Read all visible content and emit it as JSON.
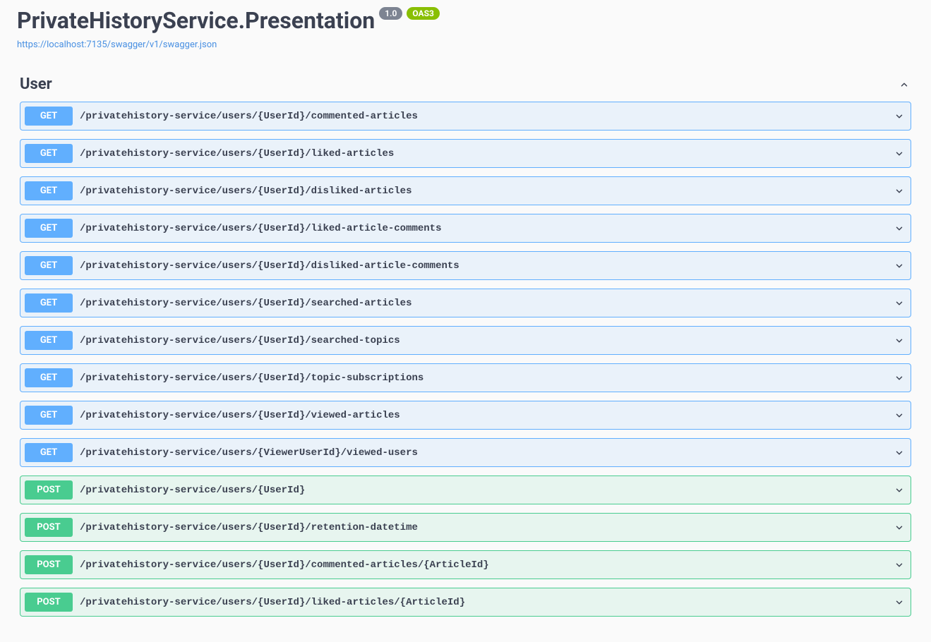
{
  "header": {
    "title": "PrivateHistoryService.Presentation",
    "version": "1.0",
    "oas": "OAS3",
    "spec_url": "https://localhost:7135/swagger/v1/swagger.json"
  },
  "tag": {
    "name": "User"
  },
  "operations": [
    {
      "method": "GET",
      "path": "/privatehistory-service/users/{UserId}/commented-articles"
    },
    {
      "method": "GET",
      "path": "/privatehistory-service/users/{UserId}/liked-articles"
    },
    {
      "method": "GET",
      "path": "/privatehistory-service/users/{UserId}/disliked-articles"
    },
    {
      "method": "GET",
      "path": "/privatehistory-service/users/{UserId}/liked-article-comments"
    },
    {
      "method": "GET",
      "path": "/privatehistory-service/users/{UserId}/disliked-article-comments"
    },
    {
      "method": "GET",
      "path": "/privatehistory-service/users/{UserId}/searched-articles"
    },
    {
      "method": "GET",
      "path": "/privatehistory-service/users/{UserId}/searched-topics"
    },
    {
      "method": "GET",
      "path": "/privatehistory-service/users/{UserId}/topic-subscriptions"
    },
    {
      "method": "GET",
      "path": "/privatehistory-service/users/{UserId}/viewed-articles"
    },
    {
      "method": "GET",
      "path": "/privatehistory-service/users/{ViewerUserId}/viewed-users"
    },
    {
      "method": "POST",
      "path": "/privatehistory-service/users/{UserId}"
    },
    {
      "method": "POST",
      "path": "/privatehistory-service/users/{UserId}/retention-datetime"
    },
    {
      "method": "POST",
      "path": "/privatehistory-service/users/{UserId}/commented-articles/{ArticleId}"
    },
    {
      "method": "POST",
      "path": "/privatehistory-service/users/{UserId}/liked-articles/{ArticleId}"
    }
  ]
}
